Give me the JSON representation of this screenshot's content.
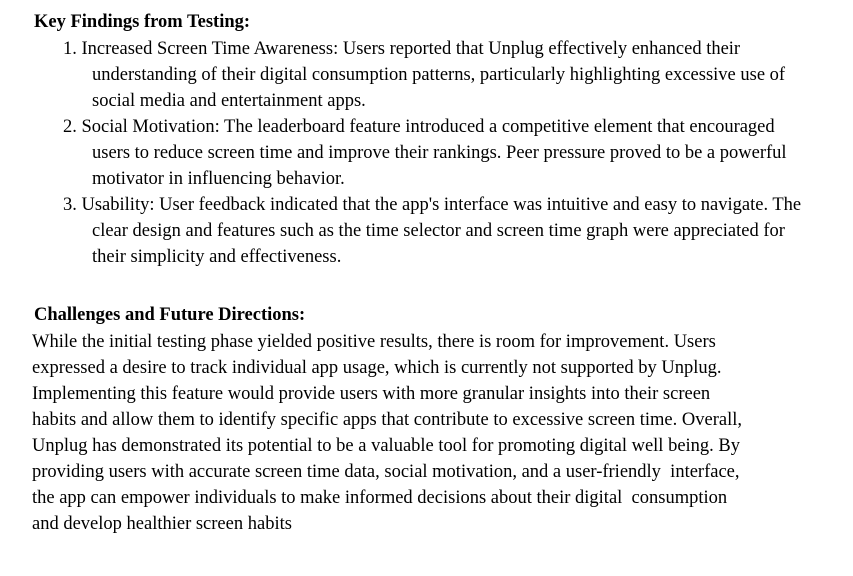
{
  "key_findings": {
    "heading": "Key Findings from Testing:",
    "items": [
      {
        "number": "1.",
        "lines": [
          "Increased Screen Time Awareness: Users reported that Unplug effectively enhanced their",
          "understanding of their digital consumption patterns, particularly highlighting excessive",
          "use of social media and entertainment apps."
        ]
      },
      {
        "number": "2.",
        "lines": [
          "Social Motivation: The leaderboard feature introduced a competitive element that",
          "encouraged users to reduce screen time and improve their rankings. Peer pressure proved",
          "to be a powerful motivator in influencing behavior."
        ]
      },
      {
        "number": "3.",
        "lines": [
          "Usability: User feedback indicated that the app's interface was intuitive and easy to",
          "navigate. The clear design and features such as the time selector and screen time graph",
          "were appreciated for their simplicity and effectiveness."
        ]
      }
    ]
  },
  "challenges": {
    "heading": "Challenges and Future Directions:",
    "lines": [
      "While the initial testing phase yielded positive results, there is room for improvement. Users",
      "expressed a desire to track individual app usage, which is currently not supported by Unplug.",
      "Implementing this feature would provide users with more granular insights into their screen",
      "habits and allow them to identify specific apps that contribute to excessive screen time. Overall,",
      "Unplug has demonstrated its potential to be a valuable tool for promoting digital well being. By",
      "providing users with accurate screen time data, social motivation, and a user-friendly  interface,",
      "the app can empower individuals to make informed decisions about their digital  consumption",
      "and develop healthier screen habits"
    ]
  }
}
